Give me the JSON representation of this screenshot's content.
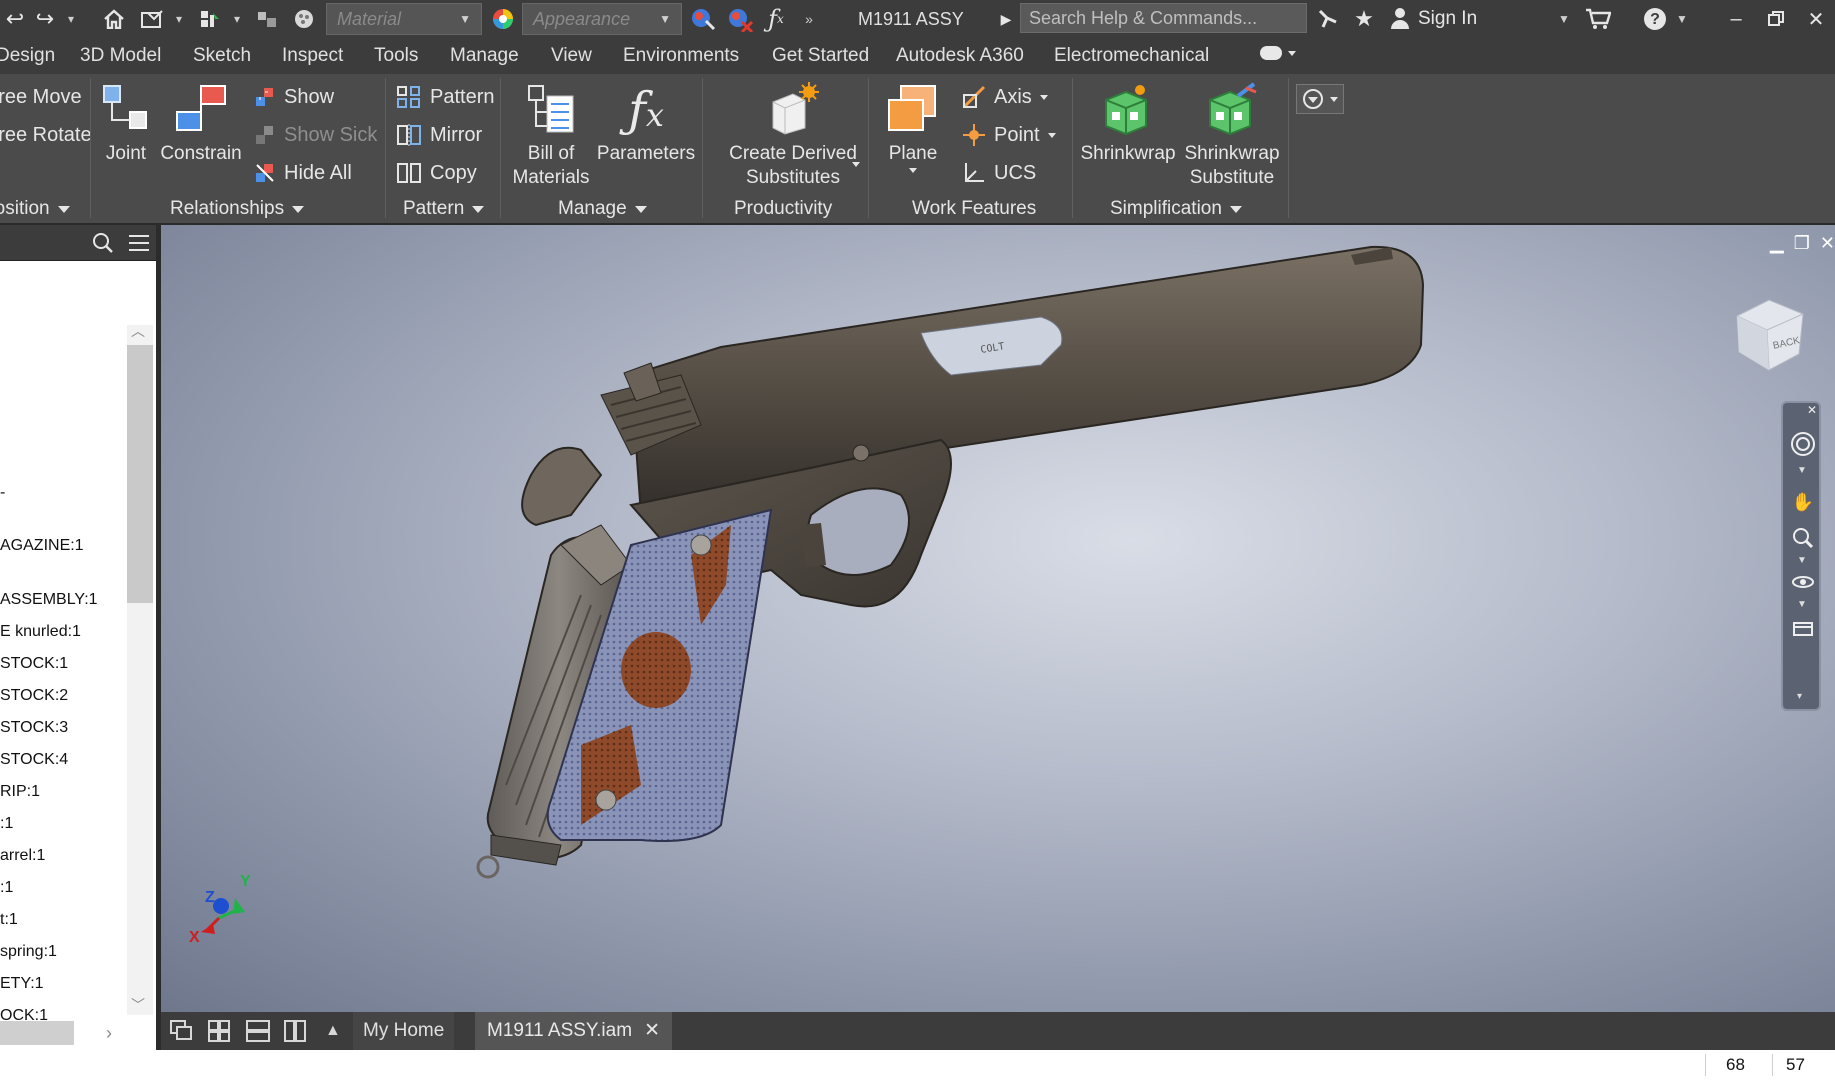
{
  "titlebar": {
    "material_placeholder": "Material",
    "appearance_placeholder": "Appearance",
    "doc_title": "M1911 ASSY",
    "search_placeholder": "Search Help & Commands...",
    "sign_in": "Sign In"
  },
  "menu_tabs": [
    "Design",
    "3D Model",
    "Sketch",
    "Inspect",
    "Tools",
    "Manage",
    "View",
    "Environments",
    "Get Started",
    "Autodesk A360",
    "Electromechanical"
  ],
  "ribbon": {
    "position": {
      "free_move": "Free Move",
      "free_rotate": "Free Rotate",
      "label": "Position"
    },
    "relationships": {
      "joint": "Joint",
      "constrain": "Constrain",
      "show": "Show",
      "show_sick": "Show Sick",
      "hide_all": "Hide All",
      "label": "Relationships"
    },
    "pattern": {
      "pattern": "Pattern",
      "mirror": "Mirror",
      "copy": "Copy",
      "label": "Pattern"
    },
    "manage": {
      "bom_line1": "Bill of",
      "bom_line2": "Materials",
      "parameters": "Parameters",
      "label": "Manage"
    },
    "productivity": {
      "cds_line1": "Create Derived",
      "cds_line2": "Substitutes",
      "label": "Productivity"
    },
    "work_features": {
      "plane": "Plane",
      "axis": "Axis",
      "point": "Point",
      "ucs": "UCS",
      "label": "Work Features"
    },
    "simplification": {
      "shrinkwrap": "Shrinkwrap",
      "shrinkwrap_sub_line1": "Shrinkwrap",
      "shrinkwrap_sub_line2": "Substitute",
      "label": "Simplification"
    }
  },
  "browser": {
    "items": [
      "AGAZINE:1",
      "ASSEMBLY:1",
      "E knurled:1",
      "STOCK:1",
      "STOCK:2",
      "STOCK:3",
      "STOCK:4",
      "RIP:1",
      ":1",
      "arrel:1",
      ":1",
      "t:1",
      " spring:1",
      "ETY:1",
      "OCK:1"
    ]
  },
  "viewcube": {
    "face_label": "BACK"
  },
  "triad": {
    "x": "X",
    "y": "Y",
    "z": "Z"
  },
  "doc_tabs": {
    "home": "My Home",
    "active": "M1911 ASSY.iam"
  },
  "status": {
    "num1": "68",
    "num2": "57"
  },
  "colors": {
    "accent": "#3c3c3c",
    "ribbon": "#4b4b4b",
    "axis_x": "#d01e1e",
    "axis_y": "#22b24c",
    "axis_z": "#1e4fd0"
  }
}
